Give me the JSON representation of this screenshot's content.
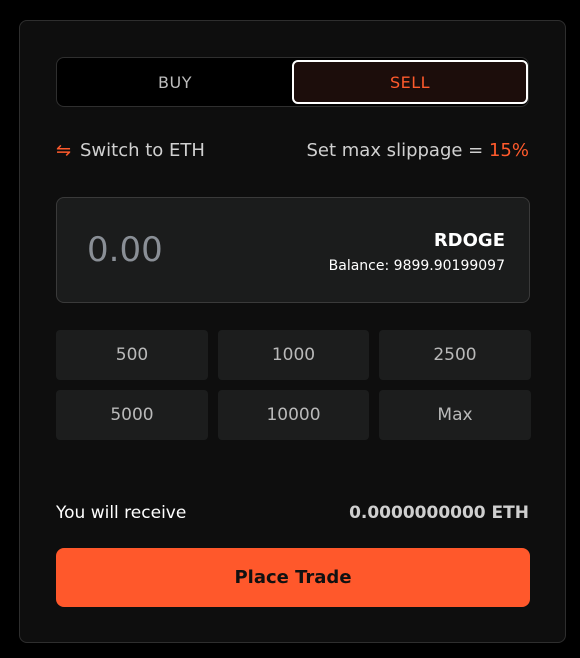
{
  "toggle": {
    "buy_label": "BUY",
    "sell_label": "SELL",
    "active": "SELL"
  },
  "switch": {
    "icon": "swap-arrows-icon",
    "label": "Switch to ETH"
  },
  "slippage": {
    "label": "Set max slippage = ",
    "value": "15%"
  },
  "amount": {
    "placeholder": "0.00",
    "value": "",
    "token": "RDOGE",
    "balance": "Balance: 9899.90199097"
  },
  "presets": [
    "500",
    "1000",
    "2500",
    "5000",
    "10000",
    "Max"
  ],
  "receive": {
    "label": "You will receive",
    "value": "0.0000000000 ETH"
  },
  "action": {
    "label": "Place Trade"
  },
  "colors": {
    "accent": "#ff582b",
    "background": "#0e0e0e",
    "panel": "#1b1c1c"
  }
}
